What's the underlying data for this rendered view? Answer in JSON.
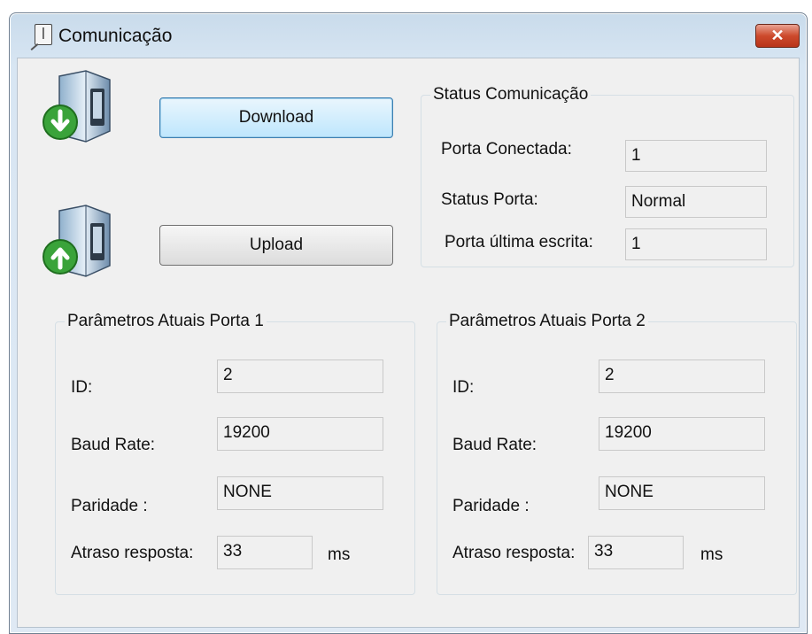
{
  "window": {
    "title": "Comunicação",
    "close_label": "✕"
  },
  "actions": {
    "download_label": "Download",
    "upload_label": "Upload"
  },
  "status": {
    "legend": "Status Comunicação",
    "connected_port_label": "Porta Conectada:",
    "connected_port_value": "1",
    "port_status_label": "Status Porta:",
    "port_status_value": "Normal",
    "last_write_label": "Porta última escrita:",
    "last_write_value": "1"
  },
  "port1": {
    "legend": "Parâmetros Atuais Porta 1",
    "id_label": "ID:",
    "id_value": "2",
    "baud_label": "Baud Rate:",
    "baud_value": "19200",
    "parity_label": "Paridade :",
    "parity_value": "NONE",
    "delay_label": "Atraso resposta:",
    "delay_value": "33",
    "delay_unit": "ms"
  },
  "port2": {
    "legend": "Parâmetros Atuais Porta 2",
    "id_label": "ID:",
    "id_value": "2",
    "baud_label": "Baud Rate:",
    "baud_value": "19200",
    "parity_label": "Paridade :",
    "parity_value": "NONE",
    "delay_label": "Atraso resposta:",
    "delay_value": "33",
    "delay_unit": "ms"
  },
  "icons": {
    "download": "server-download-icon",
    "upload": "server-upload-icon",
    "arrow_color": "#3aa33a"
  }
}
